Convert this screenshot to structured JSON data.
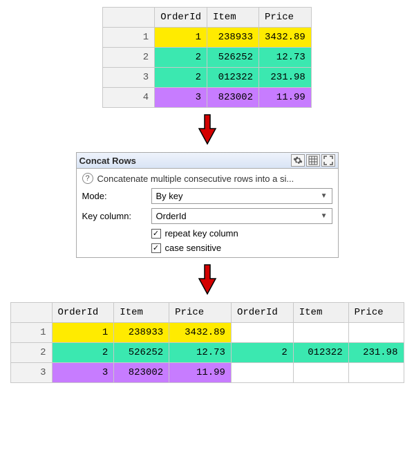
{
  "table_top": {
    "headers": [
      "OrderId",
      "Item",
      "Price"
    ],
    "rows": [
      {
        "n": "1",
        "color": "yellow",
        "cells": [
          "1",
          "238933",
          "3432.89"
        ]
      },
      {
        "n": "2",
        "color": "teal",
        "cells": [
          "2",
          "526252",
          "12.73"
        ]
      },
      {
        "n": "3",
        "color": "teal",
        "cells": [
          "2",
          "012322",
          "231.98"
        ]
      },
      {
        "n": "4",
        "color": "purple",
        "cells": [
          "3",
          "823002",
          "11.99"
        ]
      }
    ]
  },
  "panel": {
    "title": "Concat Rows",
    "description": "Concatenate multiple consecutive rows into a si...",
    "mode_label": "Mode:",
    "mode_value": "By key",
    "key_label": "Key column:",
    "key_value": "OrderId",
    "opt_repeat": "repeat key column",
    "opt_case": "case sensitive"
  },
  "table_bottom": {
    "headers": [
      "OrderId",
      "Item",
      "Price",
      "OrderId",
      "Item",
      "Price"
    ],
    "rows": [
      {
        "n": "1",
        "cells": [
          {
            "v": "1",
            "c": "yellow"
          },
          {
            "v": "238933",
            "c": "yellow"
          },
          {
            "v": "3432.89",
            "c": "yellow"
          },
          {
            "v": "",
            "c": "blank"
          },
          {
            "v": "",
            "c": "blank"
          },
          {
            "v": "",
            "c": "blank"
          }
        ]
      },
      {
        "n": "2",
        "cells": [
          {
            "v": "2",
            "c": "teal"
          },
          {
            "v": "526252",
            "c": "teal"
          },
          {
            "v": "12.73",
            "c": "teal"
          },
          {
            "v": "2",
            "c": "teal"
          },
          {
            "v": "012322",
            "c": "teal"
          },
          {
            "v": "231.98",
            "c": "teal"
          }
        ]
      },
      {
        "n": "3",
        "cells": [
          {
            "v": "3",
            "c": "purple"
          },
          {
            "v": "823002",
            "c": "purple"
          },
          {
            "v": "11.99",
            "c": "purple"
          },
          {
            "v": "",
            "c": "blank"
          },
          {
            "v": "",
            "c": "blank"
          },
          {
            "v": "",
            "c": "blank"
          }
        ]
      }
    ]
  }
}
